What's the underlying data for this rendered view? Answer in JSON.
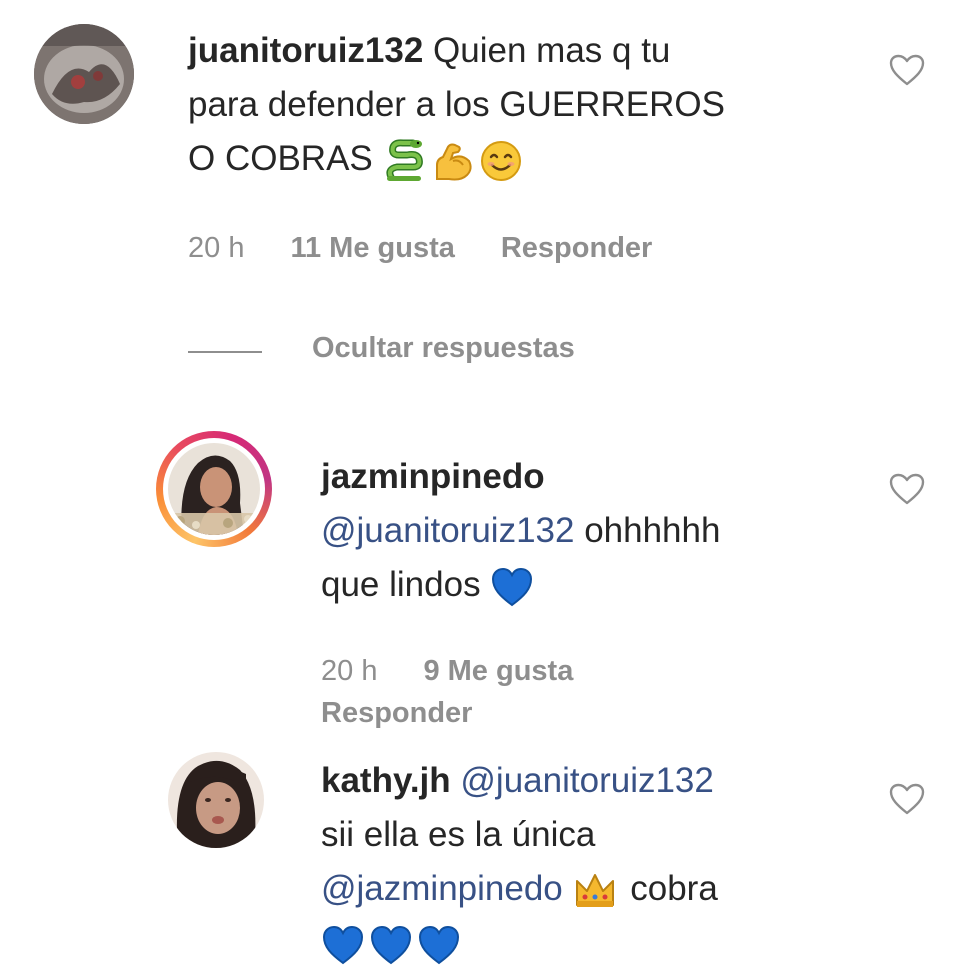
{
  "comments": [
    {
      "username": "juanitoruiz132",
      "text_line1": " Quien mas q tu",
      "text_line2": "para defender a los GUERREROS",
      "text_line3": "O COBRAS",
      "emojis": [
        "snake-emoji",
        "flexed-biceps-emoji",
        "smiling-face-emoji"
      ],
      "time": "20 h",
      "likes": "11 Me gusta",
      "reply": "Responder"
    },
    {
      "username": "jazminpinedo",
      "mention": "@juanitoruiz132",
      "text_after_mention": " ohhhhhh",
      "text_line2": "que lindos ",
      "emojis": [
        "blue-heart-emoji"
      ],
      "time": "20 h",
      "likes": "9 Me gusta",
      "reply": "Responder",
      "avatar_ring_color": "#e1306c"
    },
    {
      "username": "kathy.jh",
      "mention": "@juanitoruiz132",
      "text_line2": "sii ella es la única",
      "mention2": "@jazminpinedo",
      "text_after_mention2": " cobra",
      "emojis": [
        "crown-emoji",
        "blue-heart-emoji",
        "blue-heart-emoji",
        "blue-heart-emoji"
      ]
    }
  ],
  "toggle_replies": "Ocultar respuestas",
  "colors": {
    "text": "#262626",
    "secondary": "#8e8e8e",
    "mention": "#385185",
    "blue_heart": "#1d6fd6"
  }
}
